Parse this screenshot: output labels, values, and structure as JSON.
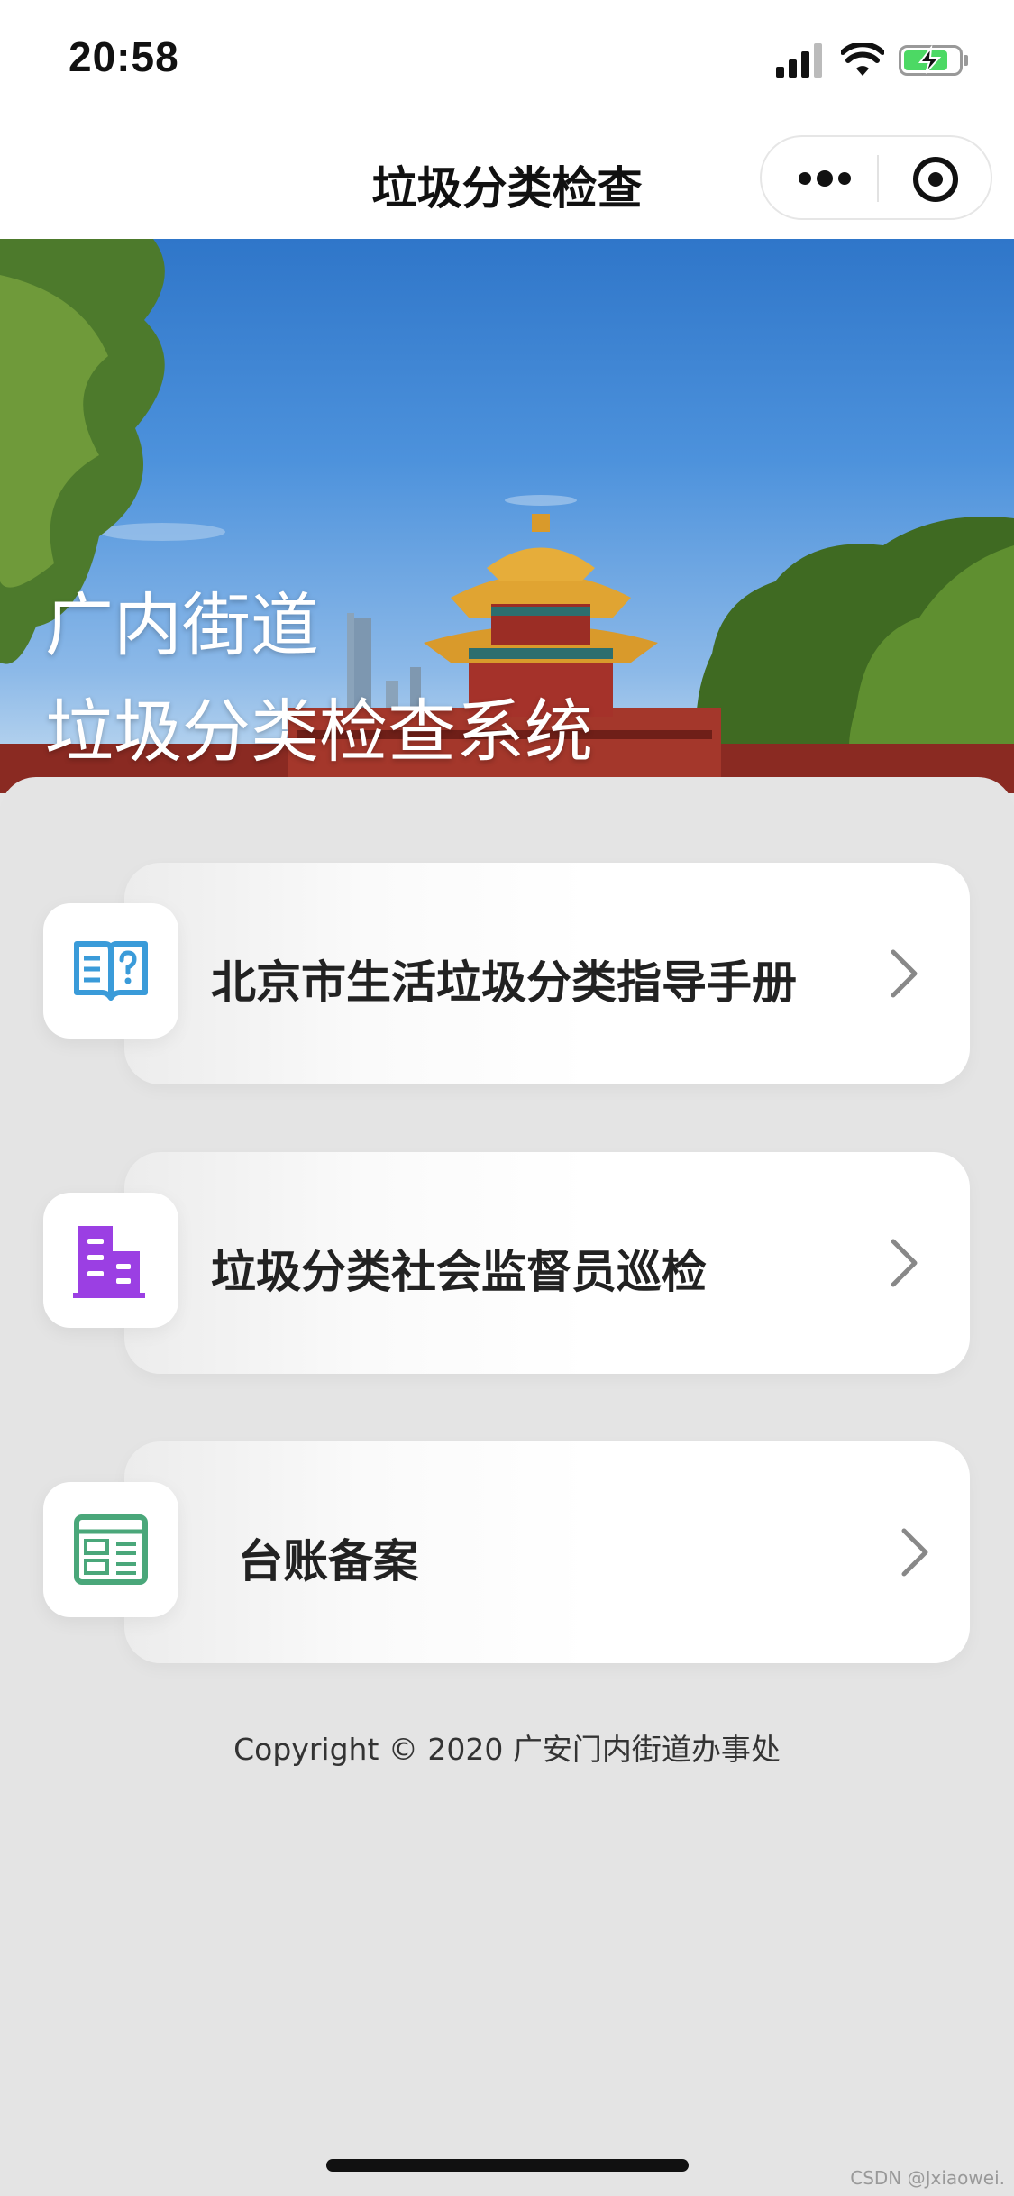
{
  "status_bar": {
    "time": "20:58"
  },
  "nav": {
    "title": "垃圾分类检查"
  },
  "banner": {
    "line1": "广内街道",
    "line2": "垃圾分类检查系统"
  },
  "menu": [
    {
      "label": "北京市生活垃圾分类指导手册",
      "icon": "book-question-icon",
      "icon_color": "#3a9bd9"
    },
    {
      "label": "垃圾分类社会监督员巡检",
      "icon": "building-icon",
      "icon_color": "#9b3fe3"
    },
    {
      "label": "台账备案",
      "icon": "ledger-icon",
      "icon_color": "#4aa77a"
    }
  ],
  "footer": {
    "copyright": "Copyright © 2020 广安门内街道办事处"
  },
  "watermark": "CSDN @Jxiaowei."
}
